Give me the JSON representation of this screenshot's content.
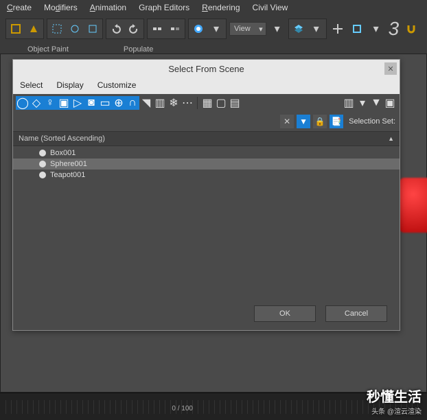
{
  "menubar": {
    "create": "Create",
    "modifiers": "Modifiers",
    "animation": "Animation",
    "graph_editors": "Graph Editors",
    "rendering": "Rendering",
    "civil_view": "Civil View"
  },
  "sublabels": {
    "object_paint": "Object Paint",
    "populate": "Populate"
  },
  "toolbar": {
    "view_dropdown": "View",
    "digit": "3"
  },
  "dialog": {
    "title": "Select From Scene",
    "menus": {
      "select": "Select",
      "display": "Display",
      "customize": "Customize"
    },
    "selection_set_label": "Selection Set:",
    "list_header": "Name (Sorted Ascending)",
    "rows": [
      {
        "name": "Box001"
      },
      {
        "name": "Sphere001"
      },
      {
        "name": "Teapot001"
      }
    ],
    "ok": "OK",
    "cancel": "Cancel"
  },
  "timeline": {
    "frame": "0 / 100"
  },
  "watermark": {
    "main": "秒懂生活",
    "sub": "头条 @渲云渲染"
  }
}
